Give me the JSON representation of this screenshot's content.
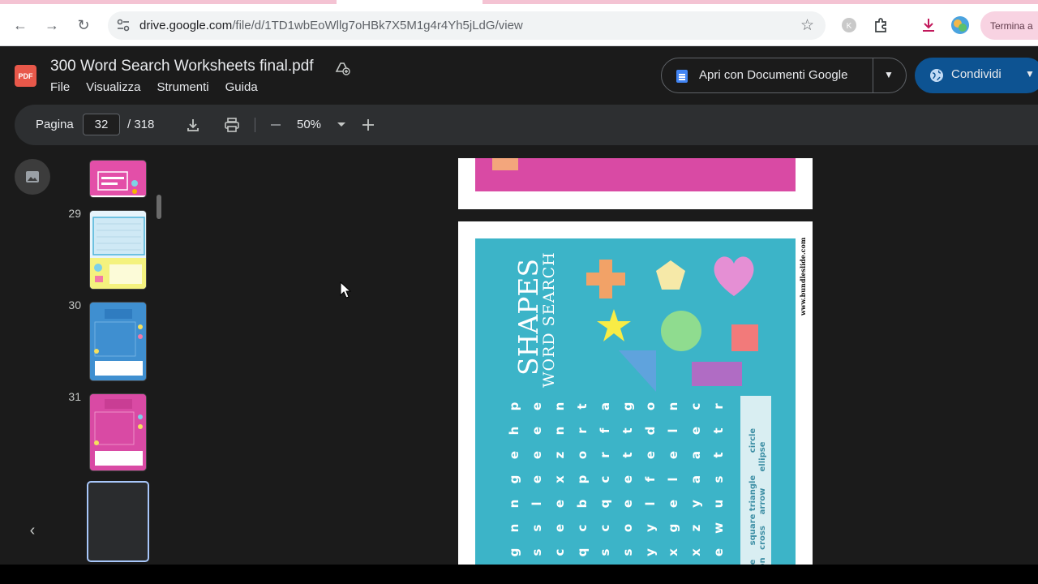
{
  "browser": {
    "url_host": "drive.google.com",
    "url_path": "/file/d/1TD1wbEoWllg7oHBk7X5M1g4r4Yh5jLdG/view",
    "profile_chip": "Termina a"
  },
  "viewer": {
    "file_badge": "PDF",
    "title": "300 Word Search Worksheets final.pdf",
    "menu": [
      "File",
      "Visualizza",
      "Strumenti",
      "Guida"
    ],
    "open_with_label": "Apri con Documenti Google",
    "share_label": "Condividi"
  },
  "pdf_toolbar": {
    "page_label": "Pagina",
    "current_page": "32",
    "total_pages": "/ 318",
    "zoom": "50%"
  },
  "thumbnails": [
    {
      "number": "",
      "colors": [
        "#e34fa8",
        "#ffffff"
      ]
    },
    {
      "number": "29",
      "colors": [
        "#cfe9f5",
        "#f4f27e"
      ]
    },
    {
      "number": "30",
      "colors": [
        "#3f8fd0",
        "#ffffff"
      ]
    },
    {
      "number": "31",
      "colors": [
        "#d94aa4",
        "#ffffff"
      ]
    },
    {
      "number": "",
      "colors": [
        "#2a2c2e"
      ]
    }
  ],
  "worksheet": {
    "title": "SHAPES",
    "subtitle": "WORD SEARCH",
    "website": "www.bundleslide.com",
    "grid_columns": [
      "phegnng",
      "eeeelss",
      "nnzxeec",
      "tropbcq",
      "afrcqcs",
      "gtteeos",
      "odeflyy",
      "nlelegx",
      "ceaayzx",
      "rttsuwe"
    ],
    "word_list_columns": [
      [
        "circle",
        "triangle",
        "square",
        "e"
      ],
      [
        "ellipse",
        "arrow",
        "cross",
        "gon"
      ]
    ]
  },
  "colors": {
    "page_panel": "#3cb4c8",
    "pink_panel": "#d94aa4",
    "share_button": "#0d5392"
  }
}
